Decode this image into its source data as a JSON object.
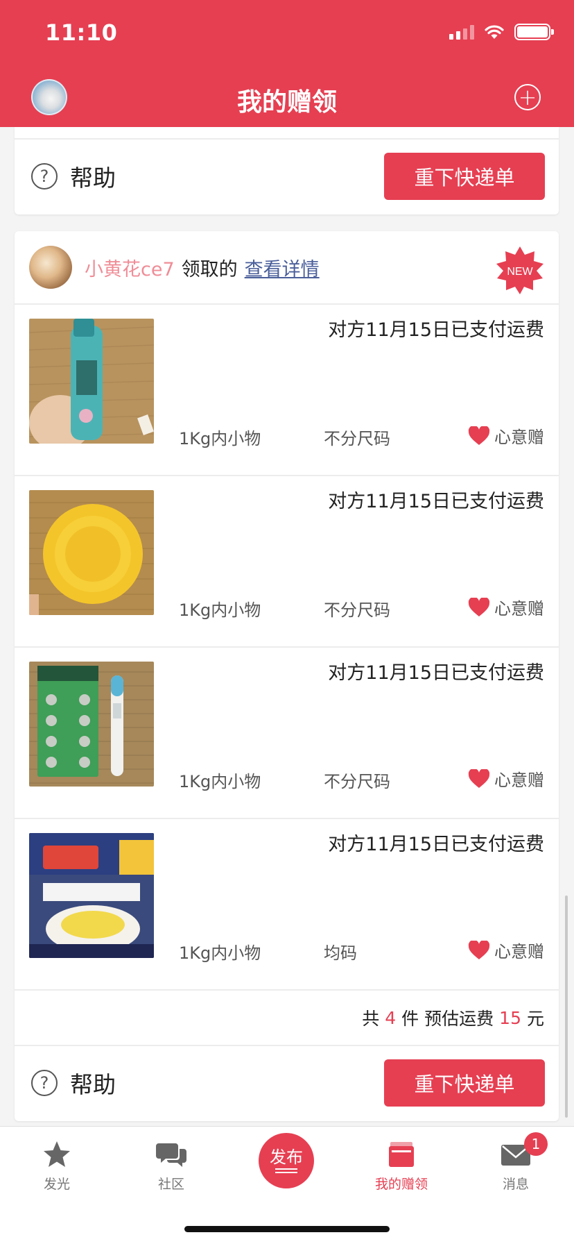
{
  "status_bar": {
    "time": "11:10"
  },
  "header": {
    "title": "我的赠领"
  },
  "top_card": {
    "help_label": "帮助",
    "button_label": "重下快递单"
  },
  "order": {
    "claimant_name": "小黄花ce7",
    "claimed_text": "领取的",
    "details_link": "查看详情",
    "badge": "NEW",
    "items": [
      {
        "status": "对方11月15日已支付运费",
        "weight": "1Kg内小物",
        "size": "不分尺码",
        "gift": "心意赠",
        "image": "teal-spray-bottle"
      },
      {
        "status": "对方11月15日已支付运费",
        "weight": "1Kg内小物",
        "size": "不分尺码",
        "gift": "心意赠",
        "image": "yellow-plastic-lid"
      },
      {
        "status": "对方11月15日已支付运费",
        "weight": "1Kg内小物",
        "size": "不分尺码",
        "gift": "心意赠",
        "image": "batteries-and-thermometer"
      },
      {
        "status": "对方11月15日已支付运费",
        "weight": "1Kg内小物",
        "size": "均码",
        "gift": "心意赠",
        "image": "salt-baked-powder-package"
      }
    ],
    "summary": {
      "prefix": "共",
      "count": "4",
      "count_unit": "件",
      "shipping_label": "预估运费",
      "shipping": "15",
      "currency": "元"
    },
    "help_label": "帮助",
    "button_label": "重下快递单"
  },
  "tabbar": {
    "tabs": [
      {
        "label": "发光",
        "icon": "star-icon"
      },
      {
        "label": "社区",
        "icon": "chat-bubbles-icon"
      },
      {
        "label": "发布",
        "icon": "publish-icon"
      },
      {
        "label": "我的赠领",
        "icon": "gift-box-icon",
        "active": true
      },
      {
        "label": "消息",
        "icon": "envelope-icon",
        "badge": "1"
      }
    ]
  },
  "colors": {
    "brand": "#e63f52",
    "claimant": "#ef8d97",
    "link": "#4a5e9a"
  }
}
